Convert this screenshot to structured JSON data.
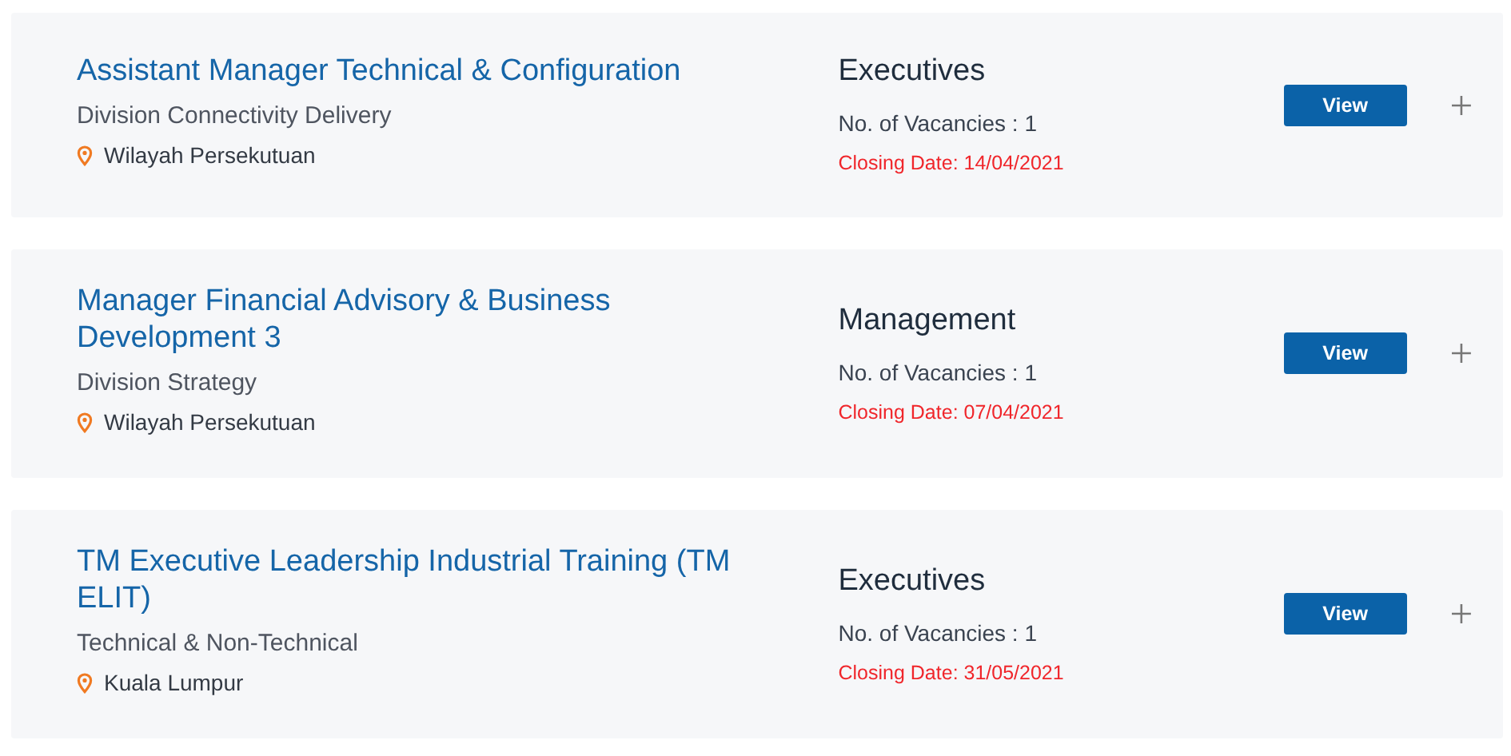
{
  "jobs": [
    {
      "title": "Assistant Manager Technical & Configuration",
      "division": "Division Connectivity Delivery",
      "location": "Wilayah Persekutuan",
      "category": "Executives",
      "vacancies": "No. of Vacancies : 1",
      "closing": "Closing Date: 14/04/2021",
      "button": "View"
    },
    {
      "title": "Manager Financial Advisory & Business Development 3",
      "division": "Division Strategy",
      "location": "Wilayah Persekutuan",
      "category": "Management",
      "vacancies": "No. of Vacancies : 1",
      "closing": "Closing Date: 07/04/2021",
      "button": "View"
    },
    {
      "title": "TM Executive Leadership Industrial Training (TM ELIT)",
      "division": "Technical & Non-Technical",
      "location": "Kuala Lumpur",
      "category": "Executives",
      "vacancies": "No. of Vacancies : 1",
      "closing": "Closing Date: 31/05/2021",
      "button": "View"
    }
  ]
}
